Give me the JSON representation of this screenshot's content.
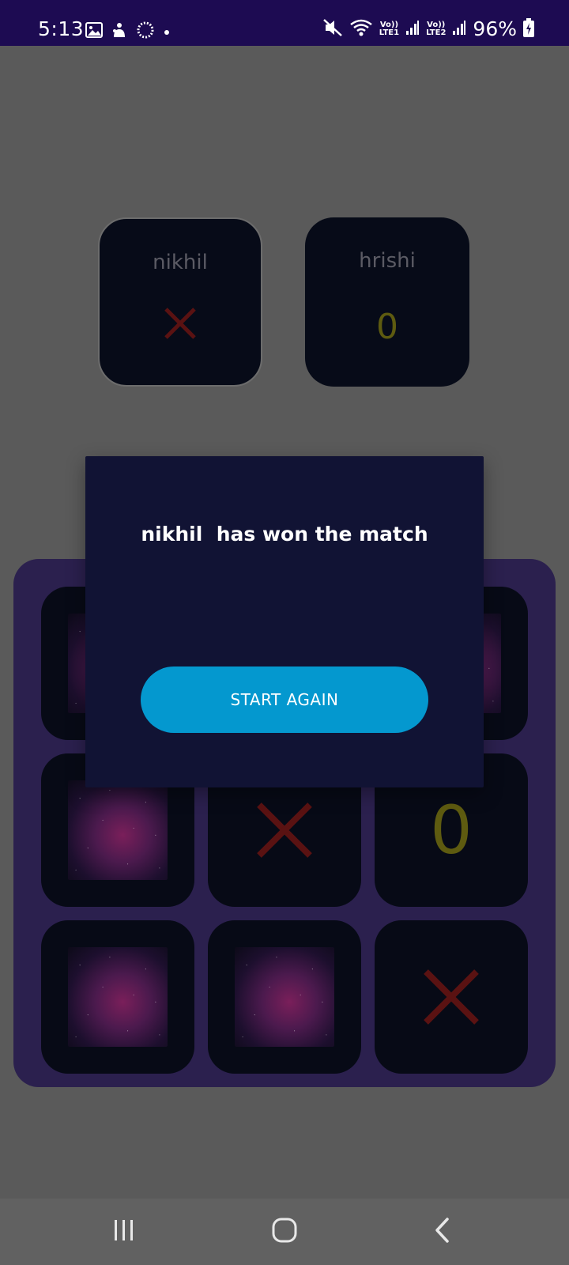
{
  "status_bar": {
    "time": "5:13",
    "battery": "96%",
    "sim1": "LTE1",
    "sim2": "LTE2",
    "volte": "Vo))",
    "icons": [
      "gallery-icon",
      "notification-icon",
      "loading-icon",
      "dot-icon",
      "mute-icon",
      "wifi-icon",
      "signal-icon",
      "battery-charging-icon"
    ]
  },
  "scoreboard": {
    "player1": {
      "name": "nikhil",
      "mark": "X"
    },
    "player2": {
      "name": "hrishi",
      "mark": "0"
    }
  },
  "board": {
    "cells": [
      {
        "state": "image"
      },
      {
        "state": "image"
      },
      {
        "state": "image"
      },
      {
        "state": "image"
      },
      {
        "state": "X"
      },
      {
        "state": "0"
      },
      {
        "state": "image"
      },
      {
        "state": "image"
      },
      {
        "state": "X"
      }
    ],
    "x_mark_label": "✕",
    "o_mark_label": "0"
  },
  "dialog": {
    "message": "nikhil  has won the match",
    "button_label": "START AGAIN"
  },
  "nav_bar": {
    "icons": [
      "recent-apps-icon",
      "home-icon",
      "back-icon"
    ]
  },
  "colors": {
    "status_bar": "#1d0b52",
    "background": "#5a5a5a",
    "card": "#070b18",
    "board": "#2b204e",
    "x_mark": "#5a1212",
    "o_mark": "#5e5b10",
    "dialog": "#111334",
    "button": "#0498cf"
  }
}
